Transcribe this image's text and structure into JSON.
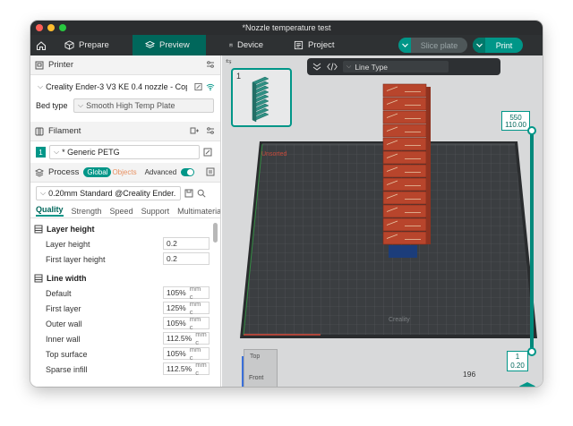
{
  "window": {
    "title": "*Nozzle temperature test"
  },
  "toolbar": {
    "tabs": [
      {
        "label": "Prepare",
        "icon": "cube-icon"
      },
      {
        "label": "Preview",
        "icon": "layers-icon",
        "active": true
      },
      {
        "label": "Device",
        "icon": "device-icon"
      },
      {
        "label": "Project",
        "icon": "project-icon"
      }
    ],
    "slice_label": "Slice plate",
    "print_label": "Print"
  },
  "printer": {
    "header": "Printer",
    "name": "Creality Ender-3 V3 KE 0.4 nozzle - Copy",
    "bed_type_label": "Bed type",
    "bed_type": "Smooth High Temp Plate"
  },
  "filament": {
    "header": "Filament",
    "index": "1",
    "name": "* Generic PETG"
  },
  "process": {
    "header": "Process",
    "global_label": "Global",
    "objects_label": "Objects",
    "advanced_label": "Advanced",
    "preset": "0.20mm Standard @Creality Ender..."
  },
  "settings_tabs": [
    "Quality",
    "Strength",
    "Speed",
    "Support",
    "Multimaterial"
  ],
  "groups": {
    "layer_height": {
      "title": "Layer height",
      "rows": [
        {
          "label": "Layer height",
          "value": "0.2",
          "unit": ""
        },
        {
          "label": "First layer height",
          "value": "0.2",
          "unit": ""
        }
      ]
    },
    "line_width": {
      "title": "Line width",
      "rows": [
        {
          "label": "Default",
          "value": "105%",
          "unit": "mm c"
        },
        {
          "label": "First layer",
          "value": "125%",
          "unit": "mm c"
        },
        {
          "label": "Outer wall",
          "value": "105%",
          "unit": "mm c"
        },
        {
          "label": "Inner wall",
          "value": "112.5%",
          "unit": "mm c"
        },
        {
          "label": "Top surface",
          "value": "105%",
          "unit": "mm c"
        },
        {
          "label": "Sparse infill",
          "value": "112.5%",
          "unit": "mm c"
        }
      ]
    }
  },
  "viewport": {
    "plate_number": "1",
    "view_type": "Line Type",
    "layer_top": "550",
    "layer_top_height": "110.00",
    "layer_bottom": "1",
    "layer_bottom_height": "0.20",
    "move_value": "196",
    "cube_top": "Top",
    "cube_front": "Front",
    "axis_x": "X"
  },
  "colors": {
    "accent": "#009688",
    "accent_dark": "#00675b",
    "tower": "#b8452c",
    "bed": "#3a3c3e"
  }
}
